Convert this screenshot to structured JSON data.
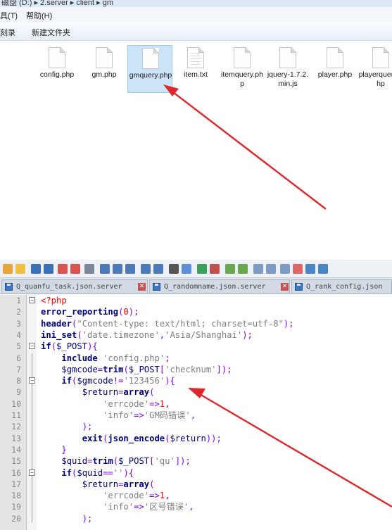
{
  "explorer": {
    "breadcrumb": "磁盘 (D:) ▸ 2.server ▸ client ▸ gm",
    "menu": {
      "tools": "具(T)",
      "help": "帮助(H)"
    },
    "toolbar": {
      "record": "刻录",
      "new_folder": "新建文件夹"
    },
    "files": [
      {
        "name": "config.php",
        "type": "php"
      },
      {
        "name": "gm.php",
        "type": "php"
      },
      {
        "name": "gmquery.php",
        "type": "php",
        "selected": true
      },
      {
        "name": "item.txt",
        "type": "txt"
      },
      {
        "name": "itemquery.php",
        "type": "php"
      },
      {
        "name": "jquery-1.7.2.min.js",
        "type": "js"
      },
      {
        "name": "player.php",
        "type": "php"
      },
      {
        "name": "playerquery.php",
        "type": "php"
      }
    ]
  },
  "editor": {
    "tabs": [
      {
        "label": "Q_quanfu_task.json.server"
      },
      {
        "label": "Q_randomname.json.server"
      },
      {
        "label": "Q_rank_config.json"
      }
    ],
    "line_numbers": [
      "1",
      "2",
      "3",
      "4",
      "5",
      "6",
      "7",
      "8",
      "9",
      "10",
      "11",
      "12",
      "13",
      "14",
      "15",
      "16",
      "17",
      "18",
      "19",
      "20"
    ]
  },
  "colors": {
    "arrow": "#e0262b",
    "selection": "#cce4f7",
    "gutter": "#e4e4e4"
  }
}
